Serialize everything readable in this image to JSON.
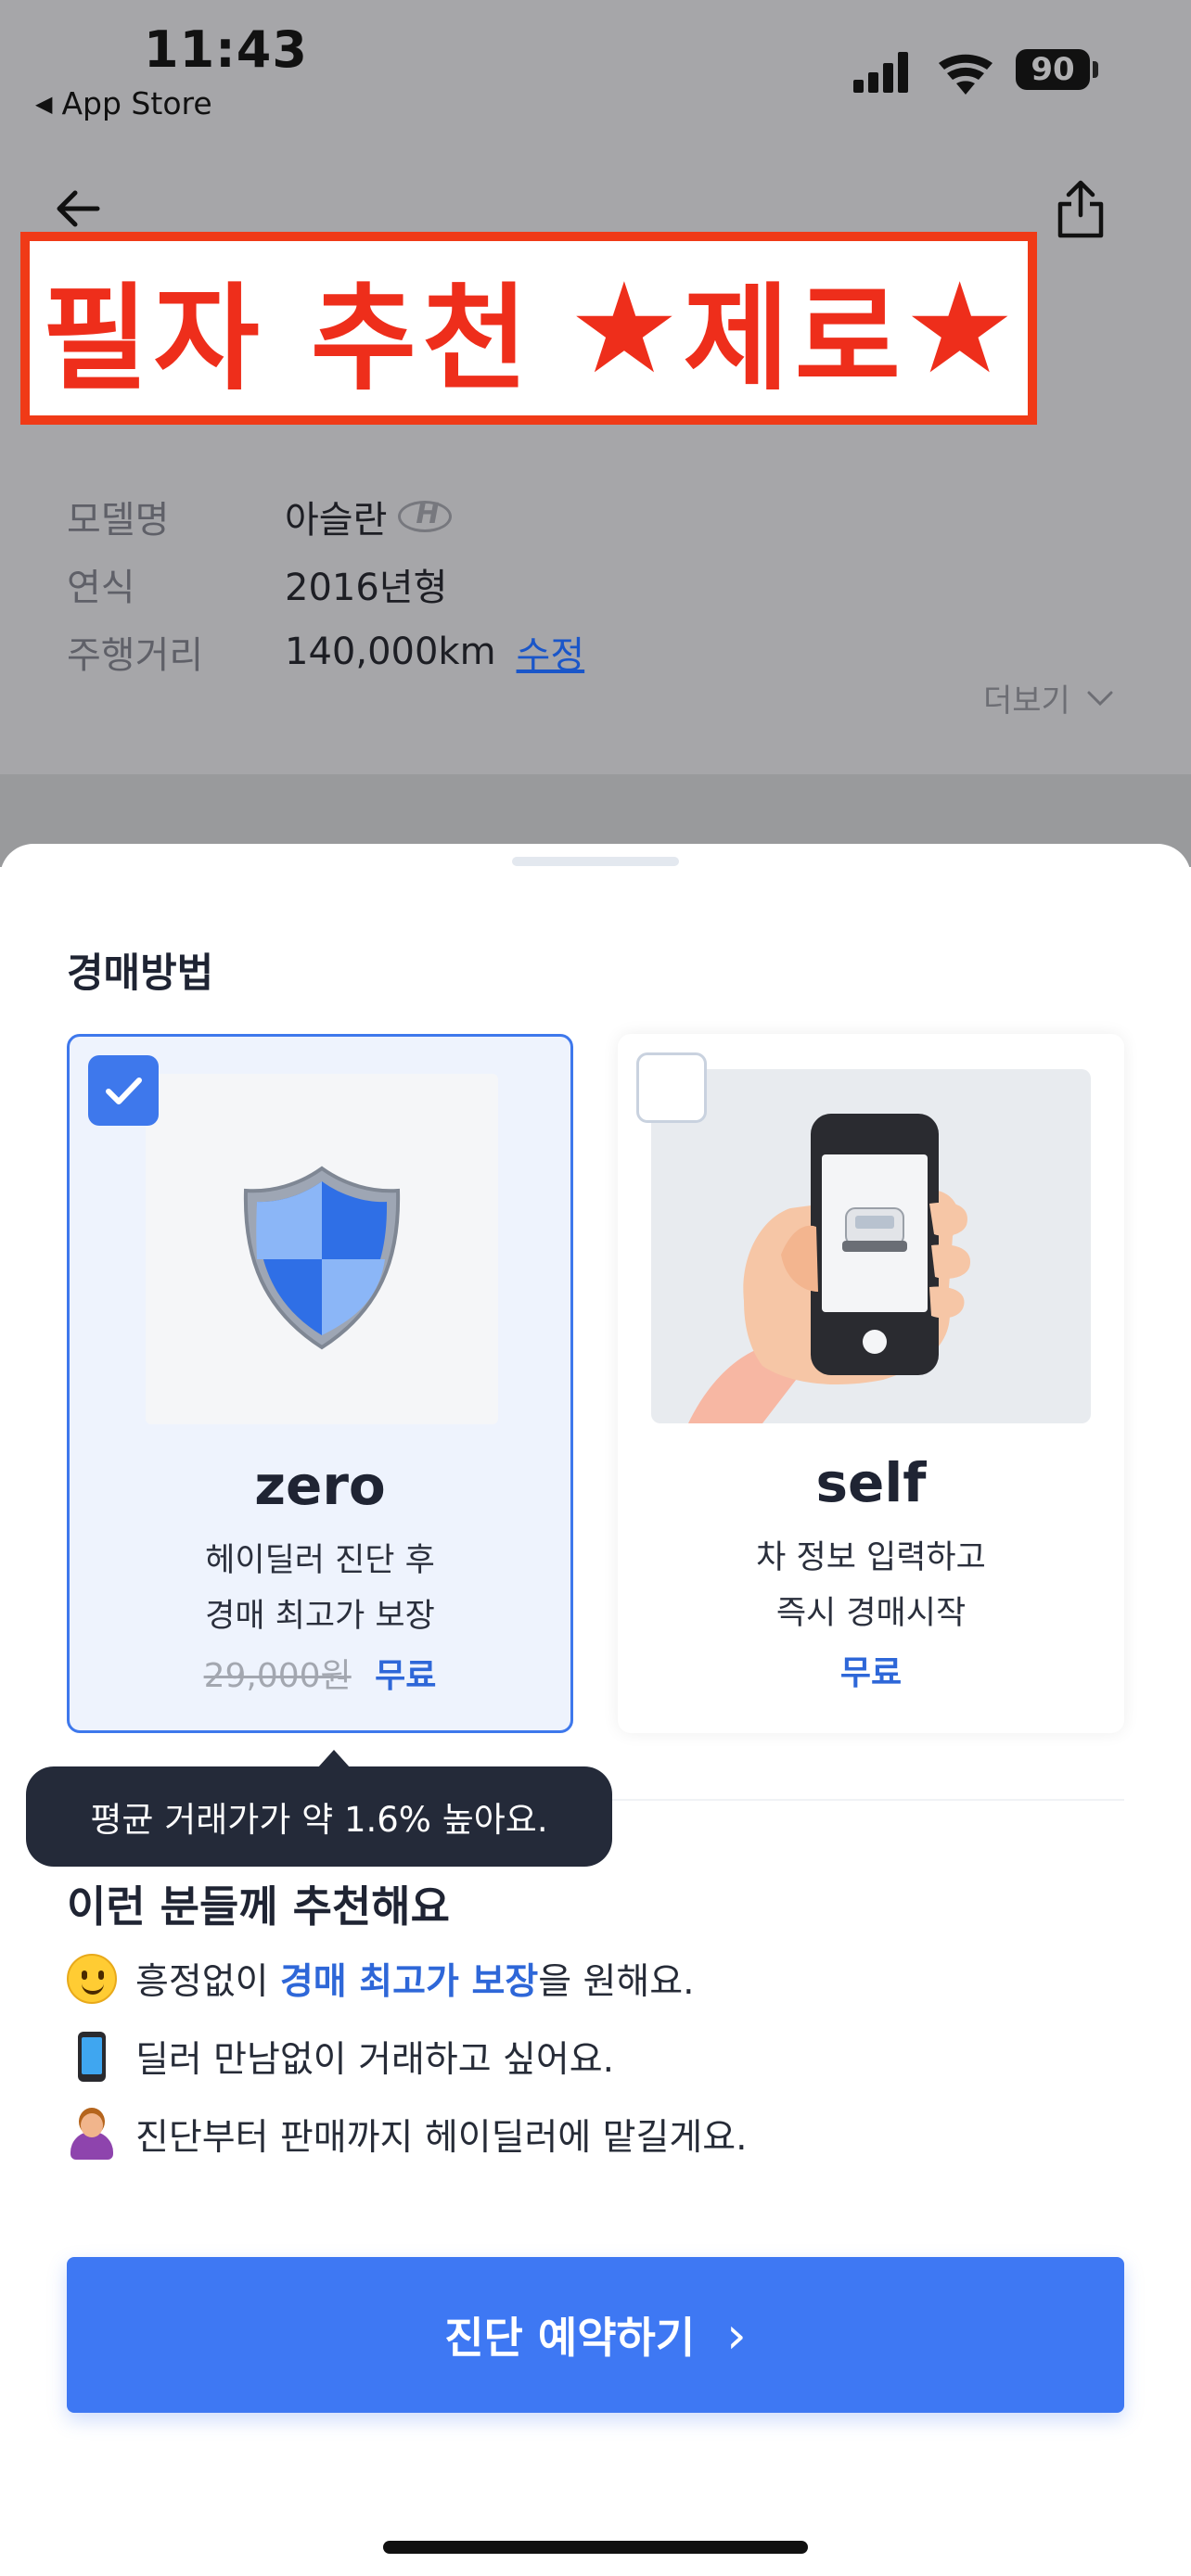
{
  "status_bar": {
    "time": "11:43",
    "back_app": "App Store",
    "battery": "90"
  },
  "banner": {
    "text_1": "필자 추천",
    "star": "★",
    "text_2": "제로"
  },
  "vehicle": {
    "rows": [
      {
        "label": "모델명",
        "value": "아슬란"
      },
      {
        "label": "연식",
        "value": "2016년형"
      },
      {
        "label": "주행거리",
        "value": "140,000km"
      }
    ],
    "edit_link": "수정",
    "more": "더보기"
  },
  "sheet": {
    "section_title": "경매방법",
    "options": [
      {
        "name": "zero",
        "desc_line1": "헤이딜러 진단 후",
        "desc_line2": "경매 최고가 보장",
        "original_price": "29,000원",
        "price": "무료",
        "selected": true,
        "icon": "shield-icon"
      },
      {
        "name": "self",
        "desc_line1": "차 정보 입력하고",
        "desc_line2": "즉시 경매시작",
        "price": "무료",
        "selected": false,
        "icon": "phone-in-hand-icon"
      }
    ],
    "tooltip": "평균 거래가가 약 1.6% 높아요.",
    "recommend_title": "이런 분들께 추천해요",
    "recommend_items": [
      {
        "icon": "smile-emoji-icon",
        "before": "흥정없이 ",
        "highlight": "경매 최고가 보장",
        "after": "을 원해요."
      },
      {
        "icon": "phone-emoji-icon",
        "text": "딜러 만남없이 거래하고 싶어요."
      },
      {
        "icon": "person-emoji-icon",
        "text": "진단부터 판매까지 헤이딜러에 맡길게요."
      }
    ],
    "cta_label": "진단 예약하기",
    "cta_chevron": "›"
  },
  "colors": {
    "accent": "#3e78f3",
    "banner_red": "#ee2e1b",
    "tooltip_bg": "#242a39",
    "dim_overlay": "#a6a6a9"
  }
}
